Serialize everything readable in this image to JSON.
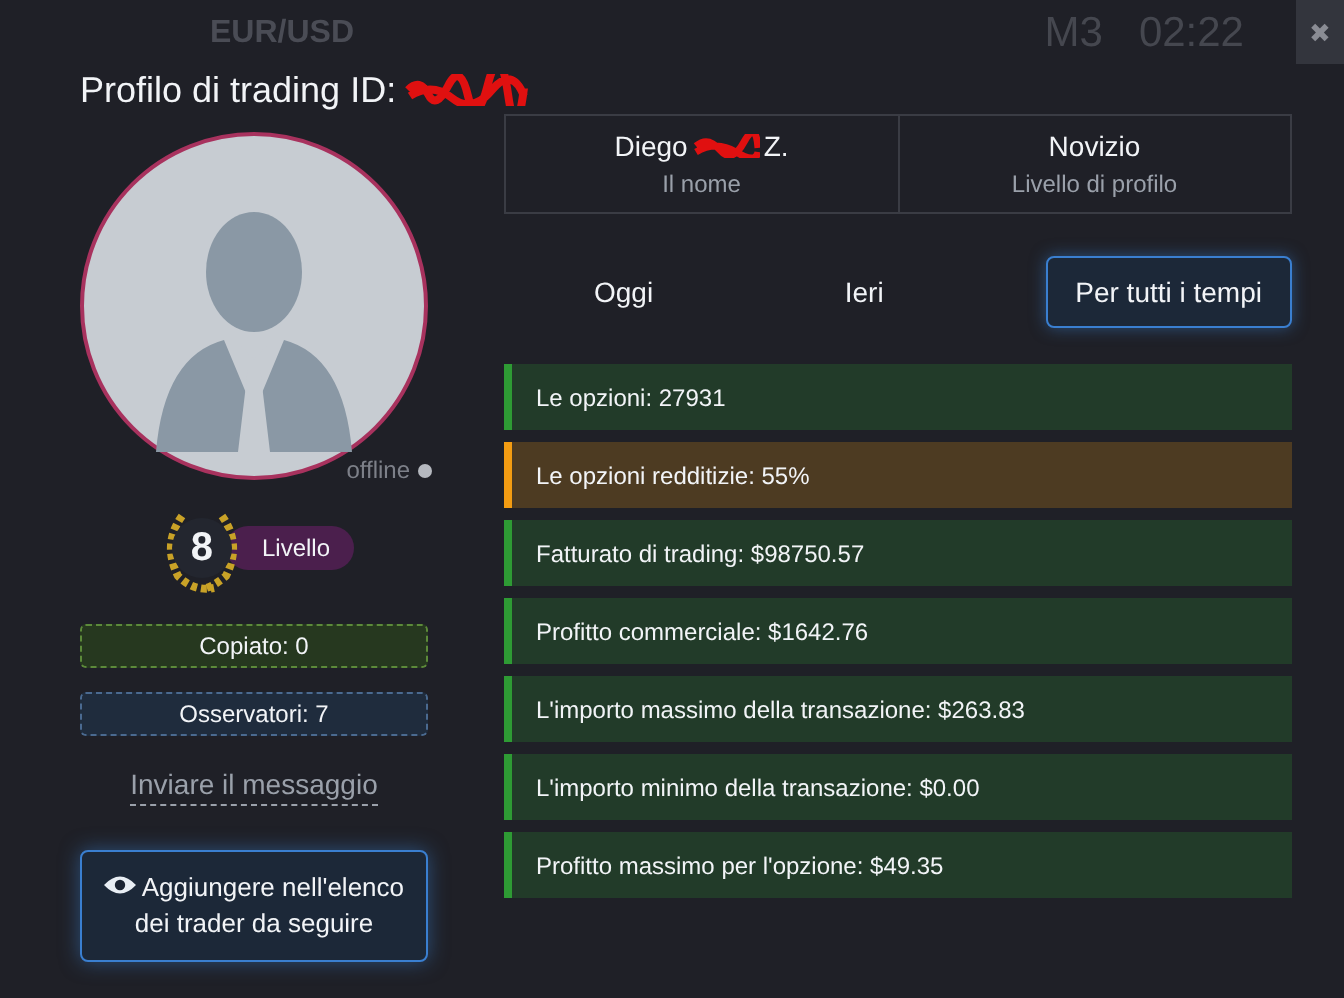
{
  "background_bar": {
    "pair": "EUR/USD",
    "timeframe": "M3",
    "clock": "02:22",
    "close": "✖"
  },
  "title": "Profilo di trading ID:",
  "profile": {
    "name_first": "Diego",
    "name_last": "Z.",
    "name_caption": "Il nome",
    "level_name": "Novizio",
    "level_caption": "Livello di profilo",
    "status": "offline",
    "level": "8",
    "level_label": "Livello"
  },
  "counters": [
    {
      "kind": "copied",
      "text": "Copiato: 0"
    },
    {
      "kind": "observers",
      "text": "Osservatori: 7"
    }
  ],
  "message_link": "Inviare il messaggio",
  "follow_button": "Aggiungere nell'elenco dei trader da seguire",
  "tabs": [
    {
      "label": "Oggi",
      "selected": false
    },
    {
      "label": "Ieri",
      "selected": false
    },
    {
      "label": "Per tutti i tempi",
      "selected": true
    }
  ],
  "stats": [
    {
      "text": "Le opzioni: 27931",
      "color": "#2e9b34"
    },
    {
      "text": "Le opzioni redditizie: 55%",
      "color": "#f39c12"
    },
    {
      "text": "Fatturato di trading: $98750.57",
      "color": "#2e9b34"
    },
    {
      "text": "Profitto commerciale: $1642.76",
      "color": "#2e9b34"
    },
    {
      "text": "L'importo massimo della transazione: $263.83",
      "color": "#2e9b34"
    },
    {
      "text": "L'importo minimo della transazione: $0.00",
      "color": "#2e9b34"
    },
    {
      "text": "Profitto massimo per l'opzione: $49.35",
      "color": "#2e9b34"
    }
  ]
}
